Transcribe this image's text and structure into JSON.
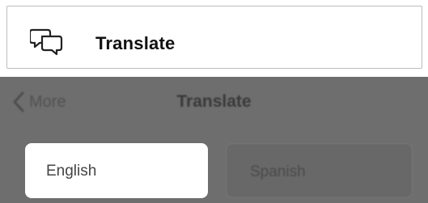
{
  "callout": {
    "icon": "chat-bubbles-icon",
    "label": "Translate"
  },
  "nav": {
    "back_icon": "chevron-left-icon",
    "back_label": "More",
    "title": "Translate"
  },
  "languages": {
    "source": "English",
    "target": "Spanish"
  },
  "colors": {
    "overlay": "#6e6e6e",
    "highlight": "#ffffff"
  }
}
